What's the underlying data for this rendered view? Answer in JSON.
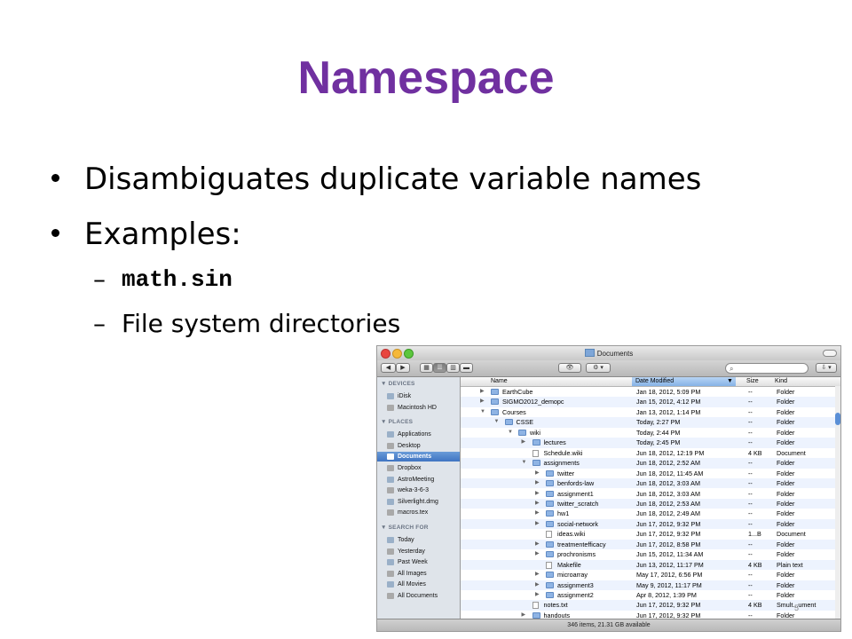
{
  "slide": {
    "title": "Namespace",
    "bullets": [
      "Disambiguates duplicate variable names",
      "Examples:"
    ],
    "sub_bullets": [
      "math.sin",
      "File system directories"
    ],
    "dash": "–"
  },
  "finder": {
    "window_title": "Documents",
    "colors": {
      "selected": "#3f74c2",
      "title": "#7030a0"
    },
    "sidebar": {
      "sections": [
        {
          "heading": "▼ DEVICES",
          "items": [
            {
              "label": "iDisk",
              "icon": "disk-icon"
            },
            {
              "label": "Macintosh HD",
              "icon": "hard-drive-icon"
            }
          ]
        },
        {
          "heading": "▼ PLACES",
          "items": [
            {
              "label": "Applications",
              "icon": "applications-icon"
            },
            {
              "label": "Desktop",
              "icon": "desktop-icon"
            },
            {
              "label": "Documents",
              "icon": "documents-icon",
              "selected": true
            },
            {
              "label": "Dropbox",
              "icon": "dropbox-icon"
            },
            {
              "label": "AstroMeeting",
              "icon": "folder-icon"
            },
            {
              "label": "weka-3-6-3",
              "icon": "tool-icon"
            },
            {
              "label": "Silverlight.dmg",
              "icon": "dmg-icon"
            },
            {
              "label": "macros.tex",
              "icon": "tex-file-icon"
            }
          ]
        },
        {
          "heading": "▼ SEARCH FOR",
          "items": [
            {
              "label": "Today",
              "icon": "clock-icon"
            },
            {
              "label": "Yesterday",
              "icon": "clock-icon"
            },
            {
              "label": "Past Week",
              "icon": "clock-icon"
            },
            {
              "label": "All Images",
              "icon": "smart-folder-icon"
            },
            {
              "label": "All Movies",
              "icon": "smart-folder-icon"
            },
            {
              "label": "All Documents",
              "icon": "smart-folder-icon"
            }
          ]
        }
      ]
    },
    "columns": {
      "name": "Name",
      "date": "Date Modified",
      "size": "Size",
      "kind": "Kind",
      "sort_indicator": "▼"
    },
    "rows": [
      {
        "indent": 0,
        "tri": "▶",
        "type": "folder",
        "name": "EarthCube",
        "date": "Jan 18, 2012, 5:09 PM",
        "size": "--",
        "kind": "Folder"
      },
      {
        "indent": 0,
        "tri": "▶",
        "type": "folder",
        "name": "SIGMO2012_demopc",
        "date": "Jan 15, 2012, 4:12 PM",
        "size": "--",
        "kind": "Folder"
      },
      {
        "indent": 0,
        "tri": "▼",
        "type": "folder",
        "name": "Courses",
        "date": "Jan 13, 2012, 1:14 PM",
        "size": "--",
        "kind": "Folder"
      },
      {
        "indent": 1,
        "tri": "▼",
        "type": "folder",
        "name": "CSSE",
        "date": "Today, 2:27 PM",
        "size": "--",
        "kind": "Folder"
      },
      {
        "indent": 2,
        "tri": "▼",
        "type": "folder",
        "name": "wiki",
        "date": "Today, 2:44 PM",
        "size": "--",
        "kind": "Folder"
      },
      {
        "indent": 3,
        "tri": "▶",
        "type": "folder",
        "name": "lectures",
        "date": "Today, 2:45 PM",
        "size": "--",
        "kind": "Folder"
      },
      {
        "indent": 3,
        "tri": "",
        "type": "doc",
        "name": "Schedule.wiki",
        "date": "Jun 18, 2012, 12:19 PM",
        "size": "4 KB",
        "kind": "Document"
      },
      {
        "indent": 3,
        "tri": "▼",
        "type": "folder",
        "name": "assignments",
        "date": "Jun 18, 2012, 2:52 AM",
        "size": "--",
        "kind": "Folder"
      },
      {
        "indent": 4,
        "tri": "▶",
        "type": "folder",
        "name": "twitter",
        "date": "Jun 18, 2012, 11:45 AM",
        "size": "--",
        "kind": "Folder"
      },
      {
        "indent": 4,
        "tri": "▶",
        "type": "folder",
        "name": "benfords-law",
        "date": "Jun 18, 2012, 3:03 AM",
        "size": "--",
        "kind": "Folder"
      },
      {
        "indent": 4,
        "tri": "▶",
        "type": "folder",
        "name": "assignment1",
        "date": "Jun 18, 2012, 3:03 AM",
        "size": "--",
        "kind": "Folder"
      },
      {
        "indent": 4,
        "tri": "▶",
        "type": "folder",
        "name": "twitter_scratch",
        "date": "Jun 18, 2012, 2:53 AM",
        "size": "--",
        "kind": "Folder"
      },
      {
        "indent": 4,
        "tri": "▶",
        "type": "folder",
        "name": "hw1",
        "date": "Jun 18, 2012, 2:49 AM",
        "size": "--",
        "kind": "Folder"
      },
      {
        "indent": 4,
        "tri": "▶",
        "type": "folder",
        "name": "social-network",
        "date": "Jun 17, 2012, 9:32 PM",
        "size": "--",
        "kind": "Folder"
      },
      {
        "indent": 4,
        "tri": "",
        "type": "doc",
        "name": "ideas.wiki",
        "date": "Jun 17, 2012, 9:32 PM",
        "size": "1...B",
        "kind": "Document"
      },
      {
        "indent": 4,
        "tri": "▶",
        "type": "folder",
        "name": "treatmentefficacy",
        "date": "Jun 17, 2012, 8:58 PM",
        "size": "--",
        "kind": "Folder"
      },
      {
        "indent": 4,
        "tri": "▶",
        "type": "folder",
        "name": "prochronisms",
        "date": "Jun 15, 2012, 11:34 AM",
        "size": "--",
        "kind": "Folder"
      },
      {
        "indent": 4,
        "tri": "",
        "type": "doc",
        "name": "Makefile",
        "date": "Jun 13, 2012, 11:17 PM",
        "size": "4 KB",
        "kind": "Plain text"
      },
      {
        "indent": 4,
        "tri": "▶",
        "type": "folder",
        "name": "microarray",
        "date": "May 17, 2012, 6:56 PM",
        "size": "--",
        "kind": "Folder"
      },
      {
        "indent": 4,
        "tri": "▶",
        "type": "folder",
        "name": "assignment3",
        "date": "May 9, 2012, 11:17 PM",
        "size": "--",
        "kind": "Folder"
      },
      {
        "indent": 4,
        "tri": "▶",
        "type": "folder",
        "name": "assignment2",
        "date": "Apr 8, 2012, 1:39 PM",
        "size": "--",
        "kind": "Folder"
      },
      {
        "indent": 3,
        "tri": "",
        "type": "doc",
        "name": "notes.txt",
        "date": "Jun 17, 2012, 9:32 PM",
        "size": "4 KB",
        "kind": "Smult...ument"
      },
      {
        "indent": 3,
        "tri": "▶",
        "type": "folder",
        "name": "handouts",
        "date": "Jun 17, 2012, 9:32 PM",
        "size": "--",
        "kind": "Folder"
      }
    ],
    "status": "346 items, 21.31 GB available",
    "page_number": "5"
  }
}
